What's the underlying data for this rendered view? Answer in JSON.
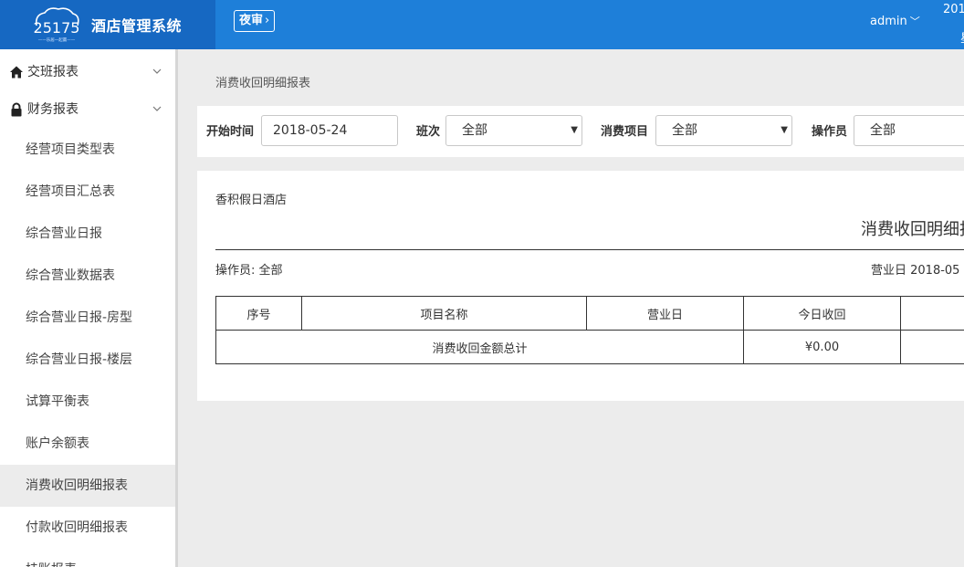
{
  "header": {
    "logo_text": "25175",
    "logo_tagline": "——乐居一起赢——",
    "app_title": "酒店管理系统",
    "night_audit_label": "夜审",
    "user": "admin",
    "date_partial": "201",
    "date_partial_line2": "星",
    "colors": {
      "topbar": "#1e7fd9",
      "brand": "#1668c2"
    }
  },
  "sidebar": {
    "groups": [
      {
        "label": "交班报表",
        "icon": "home-icon"
      },
      {
        "label": "财务报表",
        "icon": "lock-icon"
      }
    ],
    "items": [
      {
        "label": "经营项目类型表"
      },
      {
        "label": "经营项目汇总表"
      },
      {
        "label": "综合营业日报"
      },
      {
        "label": "综合营业数据表"
      },
      {
        "label": "综合营业日报-房型"
      },
      {
        "label": "综合营业日报-楼层"
      },
      {
        "label": "试算平衡表"
      },
      {
        "label": "账户余额表"
      },
      {
        "label": "消费收回明细报表",
        "active": true
      },
      {
        "label": "付款收回明细报表"
      },
      {
        "label": "挂账报表"
      }
    ]
  },
  "breadcrumb": "消费收回明细报表",
  "filters": {
    "start_time_label": "开始时间",
    "start_time_value": "2018-05-24",
    "shift_label": "班次",
    "shift_value": "全部",
    "item_label": "消费项目",
    "item_value": "全部",
    "operator_label": "操作员",
    "operator_value": "全部"
  },
  "report": {
    "hotel_name": "香积假日酒店",
    "title": "消费收回明细报",
    "operator_text": "操作员: 全部",
    "business_date_text": "营业日 2018-05",
    "columns": [
      "序号",
      "项目名称",
      "营业日",
      "今日收回",
      ""
    ],
    "total_label": "消费收回金额总计",
    "total_value": "¥0.00"
  }
}
